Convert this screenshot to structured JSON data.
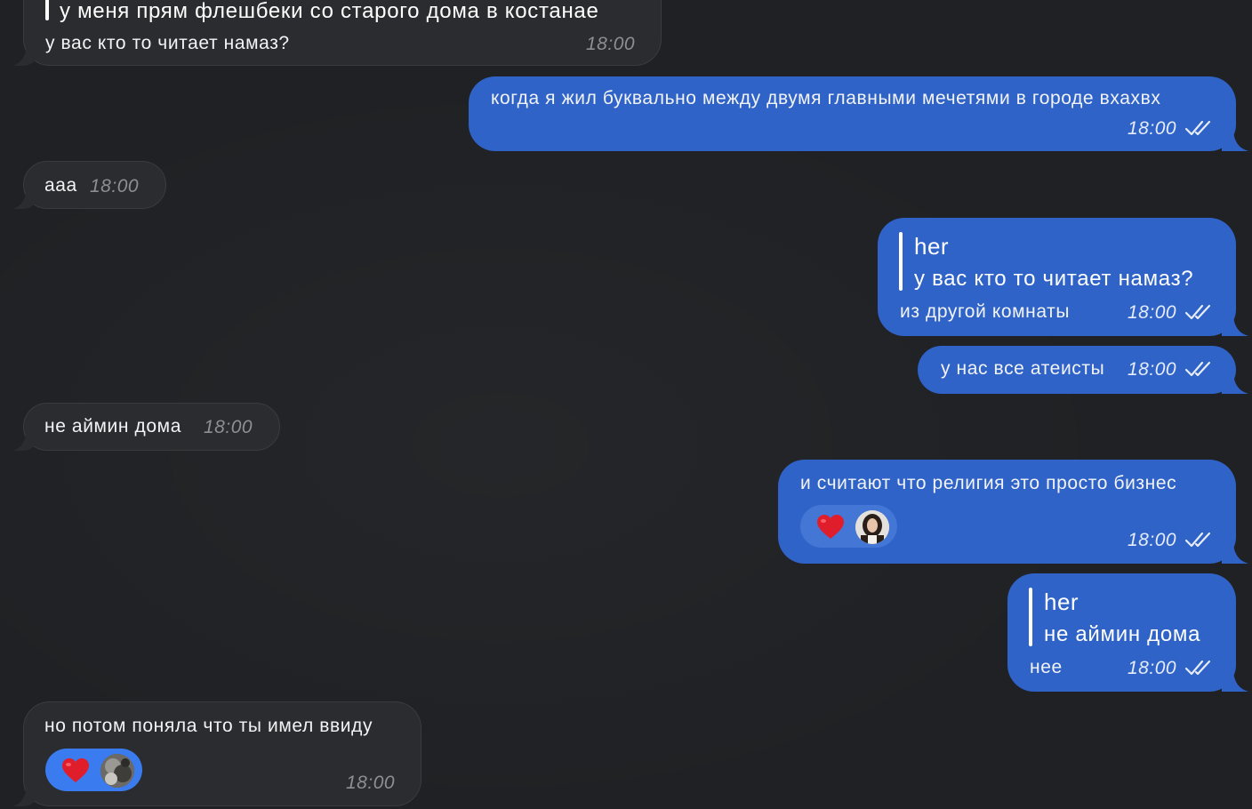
{
  "colors": {
    "background": "#1f2124",
    "incoming_bubble": "#2b2c2f",
    "outgoing_bubble": "#2f63c7",
    "reaction_on_outgoing": "#4476d6",
    "reaction_on_incoming": "#3a7cf0",
    "heart": "#e01e2b"
  },
  "messages": [
    {
      "direction": "incoming",
      "quote_text": "у меня прям флешбеки со старого дома в костанае",
      "text": "у вас кто то читает намаз?",
      "time": "18:00"
    },
    {
      "direction": "outgoing",
      "text": "когда я жил буквально между двумя главными мечетями в городе вхахвх",
      "time": "18:00",
      "status_icon": "double-check-icon"
    },
    {
      "direction": "incoming",
      "text": "ааа",
      "time": "18:00"
    },
    {
      "direction": "outgoing",
      "quote_name": "her",
      "quote_text": "у вас кто то читает намаз?",
      "text": "из другой комнаты",
      "time": "18:00",
      "status_icon": "double-check-icon"
    },
    {
      "direction": "outgoing",
      "text": "у нас все атеисты",
      "time": "18:00",
      "status_icon": "double-check-icon"
    },
    {
      "direction": "incoming",
      "text": "не аймин дома",
      "time": "18:00"
    },
    {
      "direction": "outgoing",
      "text": "и считают что религия это просто бизнес",
      "time": "18:00",
      "status_icon": "double-check-icon",
      "reaction": {
        "emoji": "heart-icon",
        "reactor": "avatar"
      }
    },
    {
      "direction": "outgoing",
      "quote_name": "her",
      "quote_text": "не аймин дома",
      "text": "нее",
      "time": "18:00",
      "status_icon": "double-check-icon"
    },
    {
      "direction": "incoming",
      "text": "но потом поняла что ты имел ввиду",
      "time": "18:00",
      "reaction": {
        "emoji": "heart-icon",
        "reactor": "avatar"
      }
    }
  ]
}
